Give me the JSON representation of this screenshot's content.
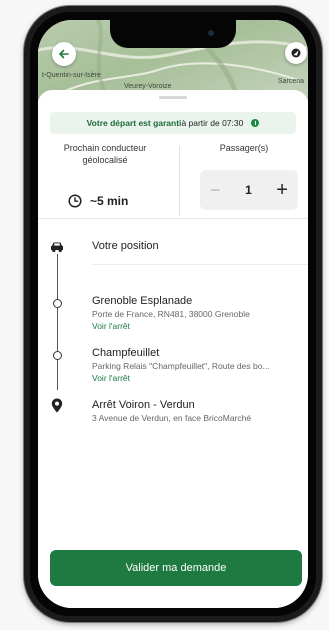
{
  "map": {
    "label_left": "t-Quentin-sur-Isère",
    "label_center": "Veurey-Voroize",
    "label_right": "Sarcena"
  },
  "banner": {
    "bold_text": "Votre départ est garanti",
    "rest_text": " à partir de 07:30"
  },
  "driver": {
    "title": "Prochain conducteur géolocalisé",
    "eta": "~5 min"
  },
  "passengers": {
    "title": "Passager(s)",
    "minus": "−",
    "value": "1",
    "plus": "+"
  },
  "route": {
    "origin_label": "Votre position",
    "stops": [
      {
        "name": "Grenoble Esplanade",
        "address": "Porte de France, RN481, 38000 Grenoble",
        "link": "Voir l'arrêt"
      },
      {
        "name": "Champfeuillet",
        "address": "Parking Relais \"Champfeuillet\", Route des bo...",
        "link": "Voir l'arrêt"
      }
    ],
    "destination": {
      "name": "Arrêt Voiron - Verdun",
      "address": "3 Avenue de Verdun, en face BricoMarché"
    }
  },
  "cta": {
    "label": "Valider ma demande"
  },
  "colors": {
    "brand_green": "#1e7a40",
    "banner_bg": "#eaf4ec"
  },
  "icons": [
    "back-arrow-icon",
    "location-pin-icon",
    "clock-icon",
    "car-icon",
    "destination-pin-icon",
    "recent-apps-icon",
    "home-icon",
    "nav-back-icon"
  ]
}
